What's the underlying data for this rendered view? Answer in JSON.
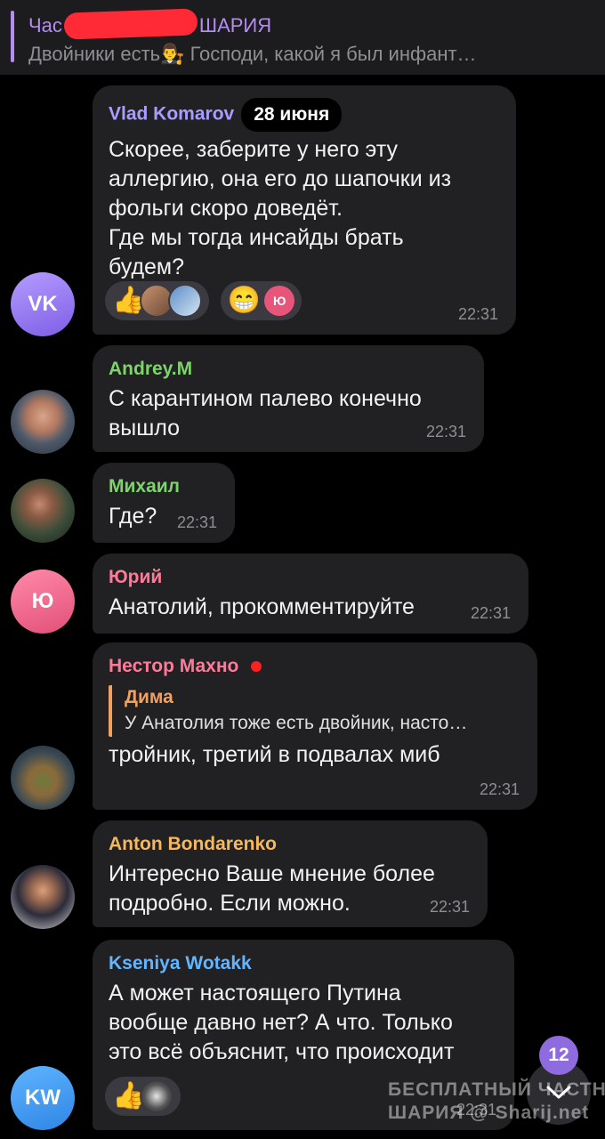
{
  "pinned": {
    "title_visible_start": "Час",
    "title_visible_end": "ШАРИЯ",
    "preview": "Двойники есть👨‍⚖️ Господи, какой я был инфант…"
  },
  "colors": {
    "background": "#000000",
    "bubble": "#212124",
    "accent": "#8e6cdf",
    "pinned_accent": "#b58cf0"
  },
  "messages": [
    {
      "avatar_initials": "VK",
      "avatar_color": "#9b7df0",
      "name": "Vlad Komarov",
      "name_color": "#a99cff",
      "date_pill": "28 июня",
      "lines": [
        "Скорее, заберите у него эту",
        "аллергию, она его до шапочки из",
        "фольги скоро доведёт.",
        "Где мы тогда инсайды брать",
        "будем?"
      ],
      "reactions": [
        {
          "emoji": "👍",
          "icon": "thumbs-up-icon"
        },
        {
          "emoji": "😁",
          "icon": "grin-icon",
          "user_initial": "Ю"
        }
      ],
      "time": "22:31"
    },
    {
      "avatar_icon": "user-photo",
      "name": "Andrey.M",
      "name_color": "#7ed36b",
      "lines": [
        "С карантином палево конечно",
        "вышло"
      ],
      "time": "22:31"
    },
    {
      "avatar_icon": "user-photo",
      "name": "Михаил",
      "name_color": "#7ed36b",
      "lines": [
        "Где?"
      ],
      "time": "22:31"
    },
    {
      "avatar_initials": "Ю",
      "avatar_color": "#ee5e86",
      "name": "Юрий",
      "name_color": "#ff7a99",
      "lines": [
        "Анатолий, прокомментируйте"
      ],
      "time": "22:31"
    },
    {
      "avatar_icon": "user-photo",
      "name": "Нестор Махно",
      "name_color": "#ff7a99",
      "reply": {
        "name": "Дима",
        "text": "У Анатолия тоже есть двойник, насто…"
      },
      "lines": [
        "тройник, третий в подвалах миб"
      ],
      "time": "22:31"
    },
    {
      "avatar_icon": "user-photo",
      "name": "Anton Bondarenko",
      "name_color": "#f6b85c",
      "lines": [
        "Интересно Ваше мнение более",
        "подробно. Если можно."
      ],
      "time": "22:31"
    },
    {
      "avatar_initials": "KW",
      "avatar_color": "#3f9cf0",
      "name": "Kseniya Wotakk",
      "name_color": "#62b5ff",
      "lines": [
        "А может настоящего Путина",
        "вообще давно нет? А что. Только",
        "это всё объяснит, что происходит"
      ],
      "reactions": [
        {
          "emoji": "👍",
          "icon": "thumbs-up-icon"
        }
      ],
      "time": "22:31"
    }
  ],
  "unread_count": "12",
  "watermark": {
    "line1": "БЕСПЛАТНЫЙ ЧАСТНЫЙ",
    "line2": "ШАРИЯ @ Sharij.net"
  }
}
